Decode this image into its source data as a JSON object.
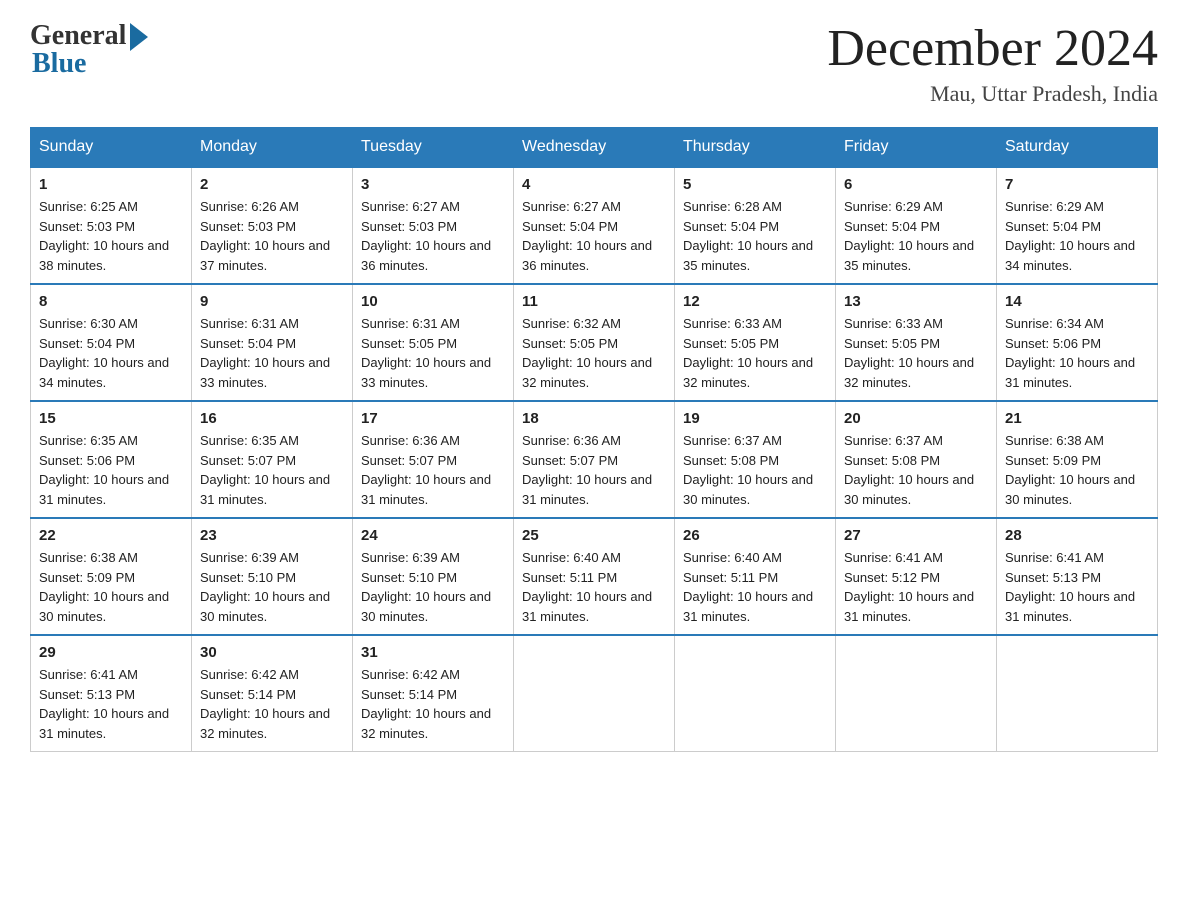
{
  "header": {
    "logo_general": "General",
    "logo_blue": "Blue",
    "month_title": "December 2024",
    "location": "Mau, Uttar Pradesh, India"
  },
  "days_of_week": [
    "Sunday",
    "Monday",
    "Tuesday",
    "Wednesday",
    "Thursday",
    "Friday",
    "Saturday"
  ],
  "weeks": [
    [
      {
        "day": "1",
        "sunrise": "6:25 AM",
        "sunset": "5:03 PM",
        "daylight": "10 hours and 38 minutes."
      },
      {
        "day": "2",
        "sunrise": "6:26 AM",
        "sunset": "5:03 PM",
        "daylight": "10 hours and 37 minutes."
      },
      {
        "day": "3",
        "sunrise": "6:27 AM",
        "sunset": "5:03 PM",
        "daylight": "10 hours and 36 minutes."
      },
      {
        "day": "4",
        "sunrise": "6:27 AM",
        "sunset": "5:04 PM",
        "daylight": "10 hours and 36 minutes."
      },
      {
        "day": "5",
        "sunrise": "6:28 AM",
        "sunset": "5:04 PM",
        "daylight": "10 hours and 35 minutes."
      },
      {
        "day": "6",
        "sunrise": "6:29 AM",
        "sunset": "5:04 PM",
        "daylight": "10 hours and 35 minutes."
      },
      {
        "day": "7",
        "sunrise": "6:29 AM",
        "sunset": "5:04 PM",
        "daylight": "10 hours and 34 minutes."
      }
    ],
    [
      {
        "day": "8",
        "sunrise": "6:30 AM",
        "sunset": "5:04 PM",
        "daylight": "10 hours and 34 minutes."
      },
      {
        "day": "9",
        "sunrise": "6:31 AM",
        "sunset": "5:04 PM",
        "daylight": "10 hours and 33 minutes."
      },
      {
        "day": "10",
        "sunrise": "6:31 AM",
        "sunset": "5:05 PM",
        "daylight": "10 hours and 33 minutes."
      },
      {
        "day": "11",
        "sunrise": "6:32 AM",
        "sunset": "5:05 PM",
        "daylight": "10 hours and 32 minutes."
      },
      {
        "day": "12",
        "sunrise": "6:33 AM",
        "sunset": "5:05 PM",
        "daylight": "10 hours and 32 minutes."
      },
      {
        "day": "13",
        "sunrise": "6:33 AM",
        "sunset": "5:05 PM",
        "daylight": "10 hours and 32 minutes."
      },
      {
        "day": "14",
        "sunrise": "6:34 AM",
        "sunset": "5:06 PM",
        "daylight": "10 hours and 31 minutes."
      }
    ],
    [
      {
        "day": "15",
        "sunrise": "6:35 AM",
        "sunset": "5:06 PM",
        "daylight": "10 hours and 31 minutes."
      },
      {
        "day": "16",
        "sunrise": "6:35 AM",
        "sunset": "5:07 PM",
        "daylight": "10 hours and 31 minutes."
      },
      {
        "day": "17",
        "sunrise": "6:36 AM",
        "sunset": "5:07 PM",
        "daylight": "10 hours and 31 minutes."
      },
      {
        "day": "18",
        "sunrise": "6:36 AM",
        "sunset": "5:07 PM",
        "daylight": "10 hours and 31 minutes."
      },
      {
        "day": "19",
        "sunrise": "6:37 AM",
        "sunset": "5:08 PM",
        "daylight": "10 hours and 30 minutes."
      },
      {
        "day": "20",
        "sunrise": "6:37 AM",
        "sunset": "5:08 PM",
        "daylight": "10 hours and 30 minutes."
      },
      {
        "day": "21",
        "sunrise": "6:38 AM",
        "sunset": "5:09 PM",
        "daylight": "10 hours and 30 minutes."
      }
    ],
    [
      {
        "day": "22",
        "sunrise": "6:38 AM",
        "sunset": "5:09 PM",
        "daylight": "10 hours and 30 minutes."
      },
      {
        "day": "23",
        "sunrise": "6:39 AM",
        "sunset": "5:10 PM",
        "daylight": "10 hours and 30 minutes."
      },
      {
        "day": "24",
        "sunrise": "6:39 AM",
        "sunset": "5:10 PM",
        "daylight": "10 hours and 30 minutes."
      },
      {
        "day": "25",
        "sunrise": "6:40 AM",
        "sunset": "5:11 PM",
        "daylight": "10 hours and 31 minutes."
      },
      {
        "day": "26",
        "sunrise": "6:40 AM",
        "sunset": "5:11 PM",
        "daylight": "10 hours and 31 minutes."
      },
      {
        "day": "27",
        "sunrise": "6:41 AM",
        "sunset": "5:12 PM",
        "daylight": "10 hours and 31 minutes."
      },
      {
        "day": "28",
        "sunrise": "6:41 AM",
        "sunset": "5:13 PM",
        "daylight": "10 hours and 31 minutes."
      }
    ],
    [
      {
        "day": "29",
        "sunrise": "6:41 AM",
        "sunset": "5:13 PM",
        "daylight": "10 hours and 31 minutes."
      },
      {
        "day": "30",
        "sunrise": "6:42 AM",
        "sunset": "5:14 PM",
        "daylight": "10 hours and 32 minutes."
      },
      {
        "day": "31",
        "sunrise": "6:42 AM",
        "sunset": "5:14 PM",
        "daylight": "10 hours and 32 minutes."
      },
      null,
      null,
      null,
      null
    ]
  ]
}
